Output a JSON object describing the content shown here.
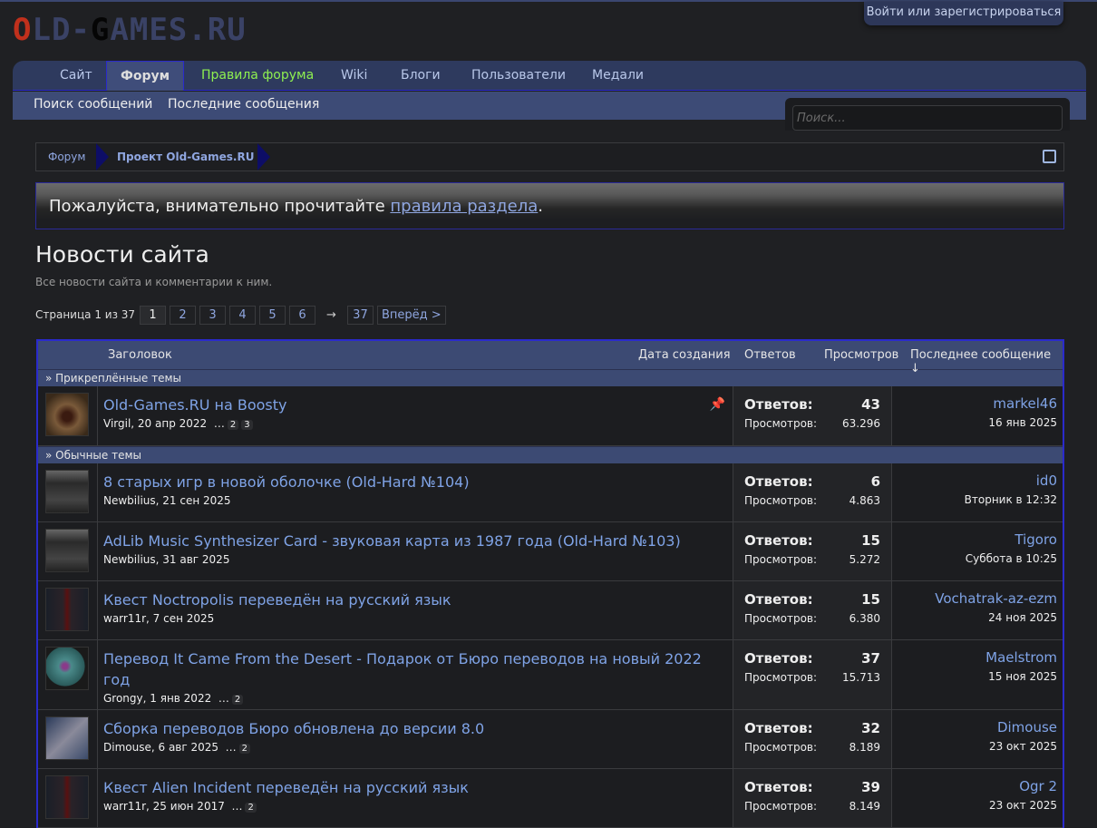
{
  "header": {
    "logo": "OLD-GAMES.RU",
    "login": "Войти или зарегистрироваться"
  },
  "nav": {
    "tabs": [
      "Сайт",
      "Форум",
      "Правила форума",
      "Wiki",
      "Блоги",
      "Пользователи",
      "Медали"
    ],
    "sub": [
      "Поиск сообщений",
      "Последние сообщения"
    ]
  },
  "search": {
    "placeholder": "Поиск..."
  },
  "breadcrumbs": [
    "Форум",
    "Проект Old-Games.RU"
  ],
  "notice": {
    "text": "Пожалуйста, внимательно прочитайте ",
    "link": "правила раздела",
    "end": "."
  },
  "page": {
    "title": "Новости сайта",
    "description": "Все новости сайта и комментарии к ним."
  },
  "pager": {
    "label": "Страница 1 из 37",
    "pages": [
      "1",
      "2",
      "3",
      "4",
      "5",
      "6"
    ],
    "arrow": "→",
    "last": "37",
    "next": "Вперёд >"
  },
  "table": {
    "headers": {
      "title": "Заголовок",
      "created": "Дата создания",
      "replies": "Ответов",
      "views": "Просмотров",
      "last": "Последнее сообщение ↓"
    },
    "stat_labels": {
      "replies": "Ответов:",
      "views": "Просмотров:"
    },
    "groups": {
      "sticky": "» Прикреплённые темы",
      "normal": "» Обычные темы"
    },
    "sticky": [
      {
        "title": "Old-Games.RU на Boosty",
        "author": "Virgil",
        "date": ", 20 апр 2022",
        "pages": [
          "2",
          "3"
        ],
        "replies": "43",
        "views": "63.296",
        "last_user": "markel46",
        "last_date": "16 янв 2025"
      }
    ],
    "threads": [
      {
        "title": "8 старых игр в новой оболочке (Old-Hard №104)",
        "author": "Newbilius",
        "date": ", 21 сен 2025",
        "replies": "6",
        "views": "4.863",
        "last_user": "id0",
        "last_date": "Вторник в 12:32"
      },
      {
        "title": "AdLib Music Synthesizer Card - звуковая карта из 1987 года (Old-Hard №103)",
        "author": "Newbilius",
        "date": ", 31 авг 2025",
        "replies": "15",
        "views": "5.272",
        "last_user": "Tigoro",
        "last_date": "Суббота в 10:25"
      },
      {
        "title": "Квест Noctropolis переведён на русский язык",
        "author": "warr11r",
        "date": ", 7 сен 2025",
        "replies": "15",
        "views": "6.380",
        "last_user": "Vochatrak-az-ezm",
        "last_date": "24 ноя 2025"
      },
      {
        "title": "Перевод It Came From the Desert - Подарок от Бюро переводов на новый 2022 год",
        "author": "Grongy",
        "date": ", 1 янв 2022",
        "pages": [
          "2"
        ],
        "replies": "37",
        "views": "15.713",
        "last_user": "Maelstrom",
        "last_date": "15 ноя 2025"
      },
      {
        "title": "Сборка переводов Бюро обновлена до версии 8.0",
        "author": "Dimouse",
        "date": ", 6 авг 2025",
        "pages": [
          "2"
        ],
        "replies": "32",
        "views": "8.189",
        "last_user": "Dimouse",
        "last_date": "23 окт 2025"
      },
      {
        "title": "Квест Alien Incident переведён на русский язык",
        "author": "warr11r",
        "date": ", 25 июн 2017",
        "pages": [
          "2"
        ],
        "replies": "39",
        "views": "8.149",
        "last_user": "Ogr 2",
        "last_date": "23 окт 2025"
      }
    ]
  }
}
